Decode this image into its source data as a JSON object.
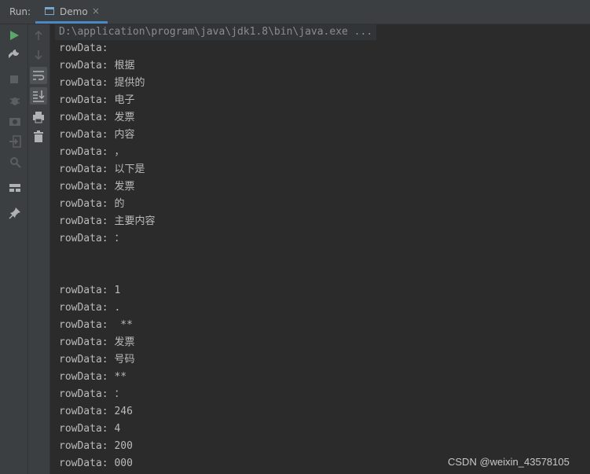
{
  "header": {
    "run_label": "Run:",
    "tab_label": "Demo",
    "tab_close": "×"
  },
  "toolbar": {
    "left": [
      "run-icon",
      "wrench-icon",
      "stop-icon",
      "debug-icon",
      "camera-icon",
      "login-icon",
      "settings-search-icon",
      "layout-icon",
      "pin-icon"
    ],
    "right": [
      "arrow-up-icon",
      "arrow-down-icon",
      "soft-wrap-icon",
      "scroll-to-end-icon",
      "print-icon",
      "trash-icon"
    ]
  },
  "console": {
    "command": "D:\\application\\program\\java\\jdk1.8\\bin\\java.exe ...",
    "lines": [
      "rowData:",
      "rowData: 根据",
      "rowData: 提供的",
      "rowData: 电子",
      "rowData: 发票",
      "rowData: 内容",
      "rowData: ，",
      "rowData: 以下是",
      "rowData: 发票",
      "rowData: 的",
      "rowData: 主要内容",
      "rowData: ：",
      "",
      "",
      "rowData: 1",
      "rowData: .",
      "rowData:  **",
      "rowData: 发票",
      "rowData: 号码",
      "rowData: **",
      "rowData: ：",
      "rowData: 246",
      "rowData: 4",
      "rowData: 200",
      "rowData: 000"
    ]
  },
  "watermark": "CSDN @weixin_43578105",
  "colors": {
    "accent": "#4a88c7",
    "run_green": "#59a869",
    "background": "#2b2b2b",
    "panel": "#3c3f41"
  }
}
